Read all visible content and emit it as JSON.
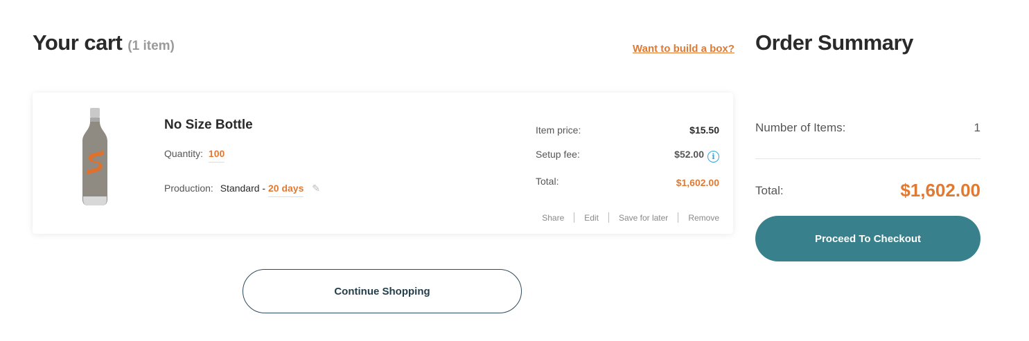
{
  "cart": {
    "title": "Your cart",
    "count": "(1 item)",
    "build_box_link": "Want to build a box?"
  },
  "item": {
    "name": "No Size Bottle",
    "quantity_label": "Quantity:",
    "quantity_value": "100",
    "production_label": "Production:",
    "production_type": "Standard -",
    "production_days": "20 days",
    "item_price_label": "Item price:",
    "item_price": "$15.50",
    "setup_fee_label": "Setup fee:",
    "setup_fee": "$52.00",
    "total_label": "Total:",
    "total": "$1,602.00",
    "actions": {
      "share": "Share",
      "edit": "Edit",
      "save_for_later": "Save for later",
      "remove": "Remove"
    },
    "icons": [
      "bottle-product-image",
      "pencil-icon",
      "info-icon"
    ]
  },
  "continue_button": "Continue Shopping",
  "summary": {
    "title": "Order Summary",
    "items_label": "Number of Items:",
    "items_count": "1",
    "total_label": "Total:",
    "total": "$1,602.00",
    "checkout_button": "Proceed To Checkout"
  },
  "colors": {
    "accent_orange": "#e07a33",
    "checkout_teal": "#37808c",
    "info_blue": "#2fa3d6"
  }
}
